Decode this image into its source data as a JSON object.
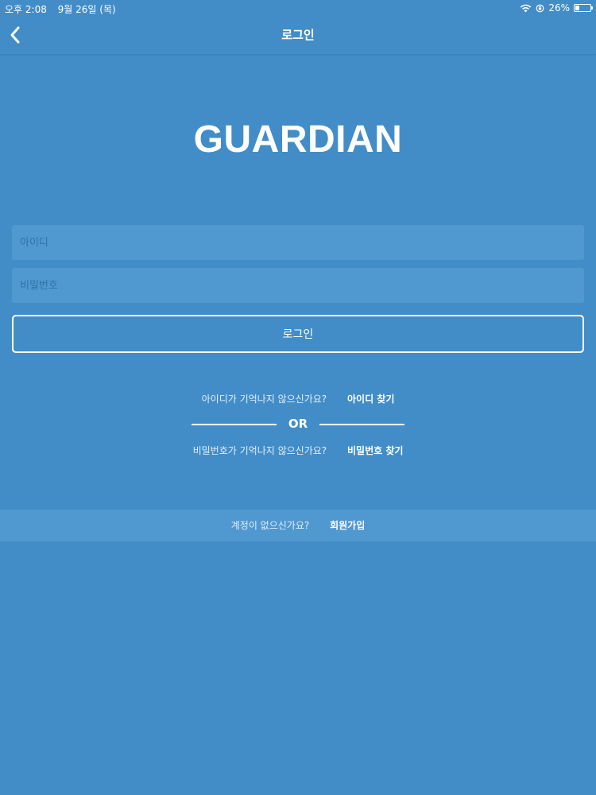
{
  "status_bar": {
    "time": "오후 2:08",
    "date": "9월 26일 (목)",
    "battery": "26%",
    "battery_level": 0.26
  },
  "nav": {
    "title": "로그인",
    "back_icon": "chevron-left-icon"
  },
  "logo": {
    "text": "GUARDIAN"
  },
  "form": {
    "id_placeholder": "아이디",
    "pw_placeholder": "비밀번호",
    "login_label": "로그인"
  },
  "help": {
    "find_id_question": "아이디가 기억나지 않으신가요?",
    "find_id_link": "아이디 찾기",
    "or_text": "OR",
    "find_pw_question": "비밀번호가 기억나지 않으신가요?",
    "find_pw_link": "비밀번호 찾기"
  },
  "signup": {
    "question": "계정이 없으신가요?",
    "link": "회원가입"
  },
  "colors": {
    "background": "#428dc8",
    "input_background": "#5098d0",
    "text": "#ffffff"
  }
}
